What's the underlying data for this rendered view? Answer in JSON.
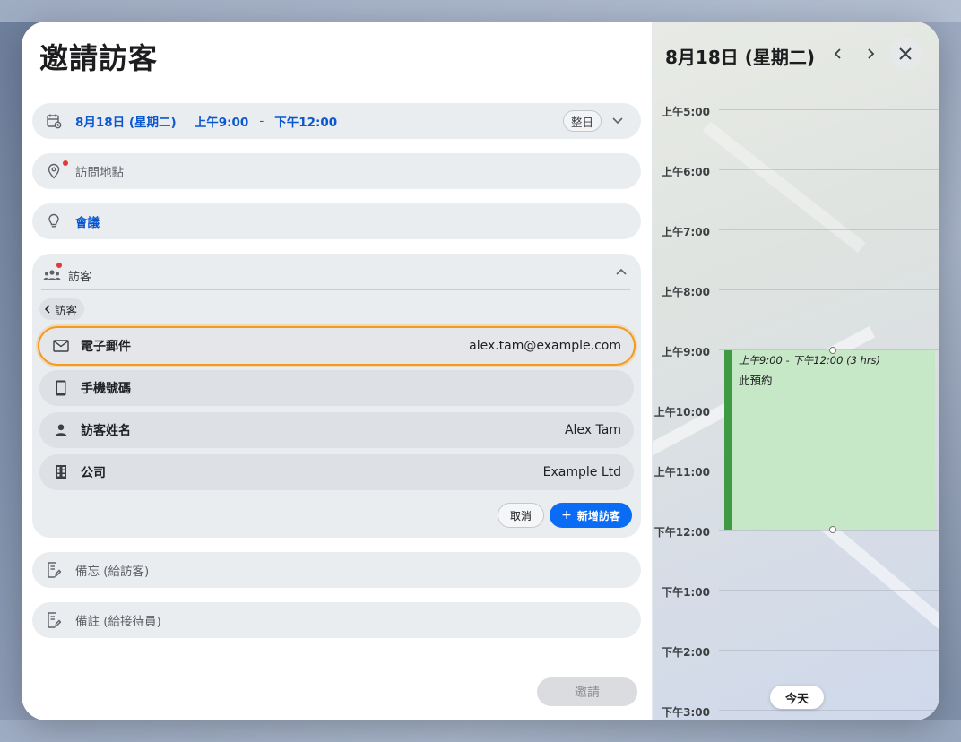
{
  "form": {
    "title": "邀請訪客",
    "date_row": {
      "date": "8月18日 (星期二)",
      "start": "上午9:00",
      "separator": "-",
      "end": "下午12:00",
      "all_day": "整日"
    },
    "location_placeholder": "訪問地點",
    "meeting_label": "會議",
    "visitors": {
      "section_label": "訪客",
      "back_label": "訪客",
      "rows": [
        {
          "label": "電子郵件",
          "value": "alex.tam@example.com",
          "icon": "mail-icon"
        },
        {
          "label": "手機號碼",
          "value": "",
          "icon": "phone-icon"
        },
        {
          "label": "訪客姓名",
          "value": "Alex Tam",
          "icon": "person-icon"
        },
        {
          "label": "公司",
          "value": "Example Ltd",
          "icon": "building-icon"
        }
      ],
      "cancel_label": "取消",
      "add_label": "新增訪客"
    },
    "memo_visitor_placeholder": "備忘 (給訪客)",
    "memo_receptionist_placeholder": "備註 (給接待員)",
    "invite_label": "邀請"
  },
  "calendar": {
    "title": "8月18日 (星期二)",
    "hours": [
      "上午5:00",
      "上午6:00",
      "上午7:00",
      "上午8:00",
      "上午9:00",
      "上午10:00",
      "上午11:00",
      "下午12:00",
      "下午1:00",
      "下午2:00",
      "下午3:00"
    ],
    "event": {
      "time": "上午9:00 - 下午12:00 (3 hrs)",
      "name": "此預約"
    },
    "today_label": "今天"
  },
  "colors": {
    "accent_blue": "#0b57d0",
    "add_button": "#0a6cf5",
    "focus_outline": "#f29b1d",
    "event_fill": "#c7e8c6",
    "event_bar": "#3f9b43",
    "required_dot": "#e53935"
  }
}
